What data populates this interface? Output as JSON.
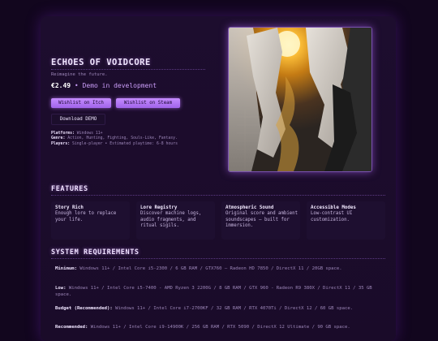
{
  "game": {
    "title": "ECHOES OF VOIDCORE",
    "tagline": "Reimagine the future.",
    "price": "€2.49",
    "price_note": "• Demo in development"
  },
  "buttons": {
    "itch": "Wishlist on Itch",
    "steam": "Wishlist on Steam",
    "demo": "Download DEMO"
  },
  "meta": {
    "platforms_label": "Platforms:",
    "platforms": "Windows 11+",
    "genre_label": "Genre:",
    "genre": "Action, Hunting, Fighting, Souls-Like, Fantasy.",
    "players_label": "Players:",
    "players": "Single-player • Estimated playtime: 6-8 hours"
  },
  "features": {
    "title": "FEATURES",
    "items": [
      {
        "title": "Story Rich",
        "desc": "Enough lore to replace your life."
      },
      {
        "title": "Lore Registry",
        "desc": "Discover machine logs, audio fragments, and ritual sigils."
      },
      {
        "title": "Atmospheric Sound",
        "desc": "Original score and ambient soundscapes — built for immersion."
      },
      {
        "title": "Accessible Modes",
        "desc": "Low-contrast UI customization."
      }
    ]
  },
  "requirements": {
    "title": "SYSTEM REQUIREMENTS",
    "items": [
      {
        "label": "Minimum:",
        "text": "Windows 11+ / Intel Core i5-2300 / 6 GB RAM / GTX760 — Radeon HD 7850 / DirectX 11 / 20GB space."
      },
      {
        "label": "Low:",
        "text": "Windows 11+ / Intel Core i5-7400 - AMD Ryzen 3 2200G / 8 GB RAM / GTX 960 - Radeon R9 380X / DirectX 11 / 35 GB space."
      },
      {
        "label": "Budget (Recommended):",
        "text": "Windows 11+ / Intel Core i7-2700KF / 32 GB RAM / RTX 4070Ti / DirectX 12 / 60 GB space."
      },
      {
        "label": "Recommended:",
        "text": "Windows 11+ / Intel Core i9-14900K / 256 GB RAM / RTX 5090 / DirectX 12 Ultimate / 90 GB space."
      }
    ]
  }
}
